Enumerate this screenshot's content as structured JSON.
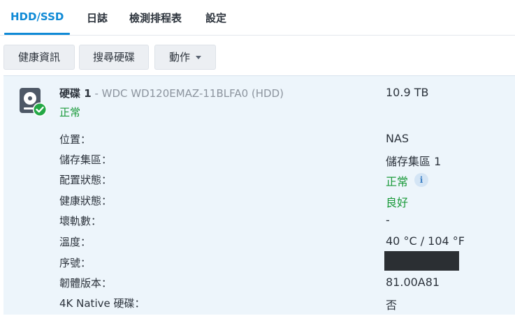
{
  "tabs": [
    {
      "label": "HDD/SSD"
    },
    {
      "label": "日誌"
    },
    {
      "label": "檢測排程表"
    },
    {
      "label": "設定"
    }
  ],
  "toolbar": {
    "health_info_label": "健康資訊",
    "search_disk_label": "搜尋硬碟",
    "action_label": "動作"
  },
  "disk": {
    "name": "硬碟 1",
    "model": " - WDC WD120EMAZ-11BLFA0 (HDD)",
    "size": "10.9 TB",
    "status": "正常",
    "status_color": "#1a9a3a",
    "icon": "hard-drive-healthy-icon"
  },
  "details": [
    {
      "label": "位置：",
      "value": "NAS"
    },
    {
      "label": "儲存集區：",
      "value": "儲存集區 1"
    },
    {
      "label": "配置狀態：",
      "value": "正常"
    },
    {
      "label": "健康狀態：",
      "value": "良好"
    },
    {
      "label": "壞軌數：",
      "value": "-"
    },
    {
      "label": "溫度：",
      "value": "40 °C / 104 °F"
    },
    {
      "label": "序號：",
      "value": ""
    },
    {
      "label": "韌體版本：",
      "value": "81.00A81"
    },
    {
      "label": "4K Native 硬碟：",
      "value": "否"
    }
  ],
  "colors": {
    "accent": "#0f8ad6",
    "success": "#1a9a3a",
    "panel_bg": "#edf5fb"
  }
}
